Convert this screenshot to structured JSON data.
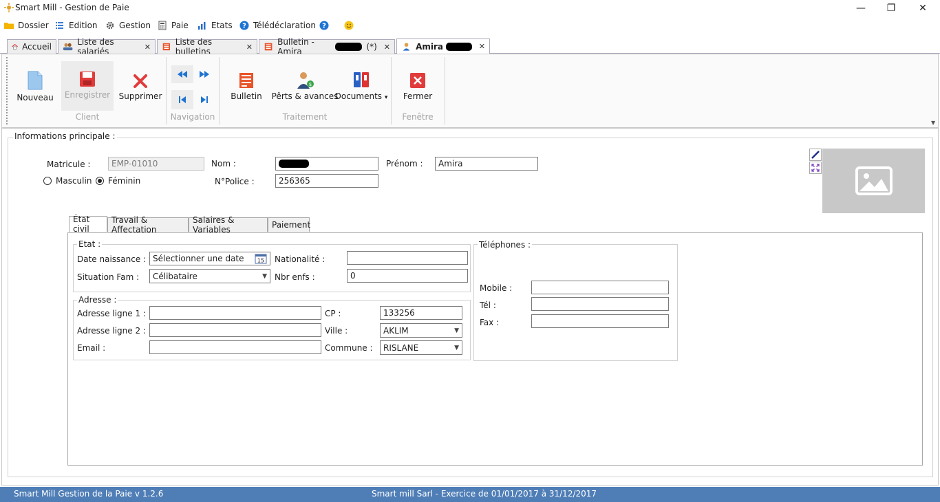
{
  "window": {
    "title": "Smart Mill - Gestion de Paie",
    "minimize": "—",
    "restore": "❐",
    "close": "✕"
  },
  "menu": {
    "items": [
      {
        "label": "Dossier",
        "icon": "folder-icon"
      },
      {
        "label": "Edition",
        "icon": "list-icon"
      },
      {
        "label": "Gestion",
        "icon": "gear-icon"
      },
      {
        "label": "Paie",
        "icon": "calculator-icon"
      },
      {
        "label": "Etats",
        "icon": "chart-icon"
      },
      {
        "label": "Télédéclaration",
        "icon": "help-icon"
      }
    ],
    "help_glyph": "?",
    "smiley_glyph": "☺"
  },
  "tabs": [
    {
      "label": "Accueil",
      "icon": "home-icon",
      "closable": false
    },
    {
      "label": "Liste des salariés",
      "icon": "people-icon",
      "closable": true
    },
    {
      "label": "Liste des bulletins",
      "icon": "document-icon",
      "closable": true
    },
    {
      "label": "Bulletin - Amira",
      "suffix": "(*)",
      "icon": "document-icon",
      "closable": true
    },
    {
      "label": "Amira",
      "icon": "user-icon",
      "closable": true,
      "active": true
    }
  ],
  "ribbon": {
    "client": {
      "group_label": "Client",
      "new": "Nouveau",
      "save": "Enregistrer",
      "delete": "Supprimer"
    },
    "navigation": {
      "group_label": "Navigation"
    },
    "traitement": {
      "group_label": "Traitement",
      "bulletin": "Bulletin",
      "loans": "Pêrts & avances",
      "documents": "Documents",
      "documents_arrow": "▾"
    },
    "fenetre": {
      "group_label": "Fenêtre",
      "close": "Fermer"
    }
  },
  "main_info": {
    "section_title": "Informations principale :",
    "matricule_label": "Matricule :",
    "matricule_value": "EMP-01010",
    "nom_label": "Nom :",
    "prenom_label": "Prénom :",
    "prenom_value": "Amira",
    "police_label": "N°Police :",
    "police_value": "256365",
    "gender": {
      "masculin": "Masculin",
      "feminin": "Féminin",
      "selected": "Féminin"
    }
  },
  "inner_tabs": [
    "État civil",
    "Travail & Affectation",
    "Salaires & Variables",
    "Paiement"
  ],
  "etat": {
    "title": "Etat :",
    "date_label": "Date naissance :",
    "date_placeholder": "Sélectionner une date",
    "calendar_day": "15",
    "nationalite_label": "Nationalité :",
    "nationalite_value": "",
    "situation_label": "Situation Fam :",
    "situation_value": "Célibataire",
    "enfants_label": "Nbr enfs :",
    "enfants_value": "0"
  },
  "adresse": {
    "title": "Adresse :",
    "ligne1_label": "Adresse ligne 1 :",
    "ligne2_label": "Adresse ligne  2 :",
    "email_label": "Email :",
    "cp_label": "CP :",
    "cp_value": "133256",
    "ville_label": "Ville :",
    "ville_value": "AKLIM",
    "commune_label": "Commune :",
    "commune_value": "RISLANE"
  },
  "telephones": {
    "title": "Téléphones  :",
    "mobile_label": "Mobile :",
    "tel_label": "Tél :",
    "fax_label": "Fax :"
  },
  "statusbar": {
    "left": "Smart Mill Gestion de la Paie v 1.2.6",
    "center": "Smart mill Sarl - Exercice de 01/01/2017 à 31/12/2017"
  },
  "colors": {
    "accent_blue": "#1e73d2",
    "status_bar": "#4f7eb7",
    "danger_red": "#e23b3b"
  }
}
